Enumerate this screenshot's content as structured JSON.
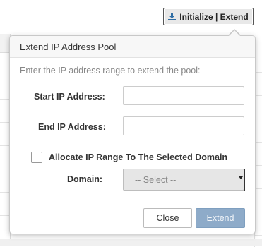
{
  "toolbar": {
    "initialize_extend_label": "Initialize | Extend",
    "icon": "download-icon"
  },
  "popover": {
    "title": "Extend IP Address Pool",
    "hint": "Enter the IP address range to extend the pool:",
    "start_ip_label": "Start IP Address:",
    "start_ip_value": "",
    "end_ip_label": "End IP Address:",
    "end_ip_value": "",
    "allocate_label": "Allocate IP Range To The Selected Domain",
    "allocate_checked": false,
    "domain_label": "Domain:",
    "domain_select_value": "-- Select --",
    "close_label": "Close",
    "extend_label": "Extend"
  },
  "colors": {
    "extend_button": "#8eabc9",
    "header_bg": "#f7f7f7",
    "select_bg": "#e6e6e6"
  }
}
